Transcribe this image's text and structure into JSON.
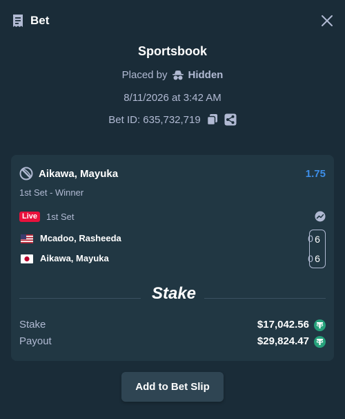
{
  "header": {
    "title": "Bet",
    "bet_icon": "receipt-icon",
    "close_icon": "close-icon"
  },
  "info": {
    "brand": "Sportsbook",
    "placed_by_prefix": "Placed by",
    "placed_by_user": "Hidden",
    "date": "8/11/2026 at 3:42 AM",
    "bet_id": "Bet ID: 635,732,719"
  },
  "selection": {
    "name": "Aikawa, Mayuka",
    "odds": "1.75",
    "market": "1st Set - Winner",
    "live_label": "Live",
    "period": "1st Set"
  },
  "players": [
    {
      "name": "Mcadoo, Rasheeda",
      "points": "0",
      "set_score": "6",
      "flag": "us-flag"
    },
    {
      "name": "Aikawa, Mayuka",
      "points": "0",
      "set_score": "6",
      "flag": "jp-flag"
    }
  ],
  "summary": {
    "stake_label": "Stake",
    "stake_value": "$17,042.56",
    "payout_label": "Payout",
    "payout_value": "$29,824.47",
    "currency_icon": "tether-icon"
  },
  "logo_text": "Stake",
  "actions": {
    "add_to_slip": "Add to Bet Slip"
  },
  "colors": {
    "background": "#1a2c38",
    "card": "#213743",
    "odds": "#3d8ee8",
    "live": "#e9113c",
    "tether": "#26a17b",
    "button": "#2f4553"
  }
}
